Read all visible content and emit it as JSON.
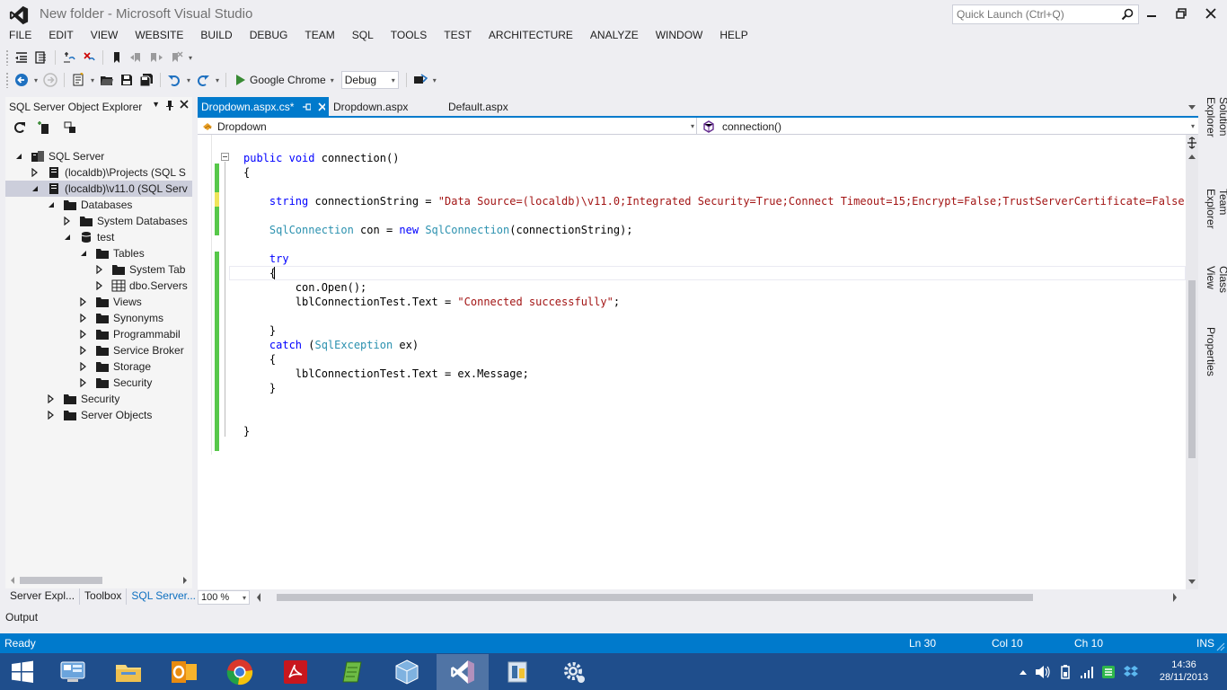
{
  "window": {
    "title": "New folder - Microsoft Visual Studio",
    "quick_launch_placeholder": "Quick Launch (Ctrl+Q)"
  },
  "menu": [
    "FILE",
    "EDIT",
    "VIEW",
    "WEBSITE",
    "BUILD",
    "DEBUG",
    "TEAM",
    "SQL",
    "TOOLS",
    "TEST",
    "ARCHITECTURE",
    "ANALYZE",
    "WINDOW",
    "HELP"
  ],
  "toolbar": {
    "run_target": "Google Chrome",
    "configuration": "Debug"
  },
  "sql_explorer": {
    "title": "SQL Server Object Explorer",
    "tree": [
      {
        "label": "SQL Server",
        "depth": 0,
        "expanded": true,
        "icon": "server-group-icon"
      },
      {
        "label": "(localdb)\\Projects (SQL S",
        "depth": 1,
        "expanded": false,
        "icon": "server-icon"
      },
      {
        "label": "(localdb)\\v11.0 (SQL Serv",
        "depth": 1,
        "expanded": true,
        "icon": "server-icon",
        "selected": true
      },
      {
        "label": "Databases",
        "depth": 2,
        "expanded": true,
        "icon": "folder-icon"
      },
      {
        "label": "System Databases",
        "depth": 3,
        "expanded": false,
        "icon": "folder-icon"
      },
      {
        "label": "test",
        "depth": 3,
        "expanded": true,
        "icon": "database-icon"
      },
      {
        "label": "Tables",
        "depth": 4,
        "expanded": true,
        "icon": "folder-icon"
      },
      {
        "label": "System Tab",
        "depth": 5,
        "expanded": false,
        "icon": "folder-icon"
      },
      {
        "label": "dbo.Servers",
        "depth": 5,
        "expanded": false,
        "icon": "table-icon"
      },
      {
        "label": "Views",
        "depth": 4,
        "expanded": false,
        "icon": "folder-icon"
      },
      {
        "label": "Synonyms",
        "depth": 4,
        "expanded": false,
        "icon": "folder-icon"
      },
      {
        "label": "Programmabil",
        "depth": 4,
        "expanded": false,
        "icon": "folder-icon"
      },
      {
        "label": "Service Broker",
        "depth": 4,
        "expanded": false,
        "icon": "folder-icon"
      },
      {
        "label": "Storage",
        "depth": 4,
        "expanded": false,
        "icon": "folder-icon"
      },
      {
        "label": "Security",
        "depth": 4,
        "expanded": false,
        "icon": "folder-icon"
      },
      {
        "label": "Security",
        "depth": 2,
        "expanded": false,
        "icon": "folder-icon"
      },
      {
        "label": "Server Objects",
        "depth": 2,
        "expanded": false,
        "icon": "folder-icon"
      }
    ],
    "bottom_tabs": [
      "Server Expl...",
      "Toolbox",
      "SQL Server..."
    ],
    "active_bottom_tab": 2
  },
  "output_label": "Output",
  "doc_tabs": [
    {
      "label": "Dropdown.aspx.cs*",
      "active": true
    },
    {
      "label": "Dropdown.aspx",
      "active": false
    },
    {
      "label": "Default.aspx",
      "active": false
    }
  ],
  "navbar": {
    "type_combo": "Dropdown",
    "member_combo": "connection()"
  },
  "code": [
    [
      [
        "kw",
        "public"
      ],
      [
        "t",
        " "
      ],
      [
        "kw",
        "void"
      ],
      [
        "t",
        " connection()"
      ]
    ],
    [
      [
        "t",
        "{"
      ]
    ],
    [],
    [
      [
        "t",
        "    "
      ],
      [
        "kw",
        "string"
      ],
      [
        "t",
        " connectionString = "
      ],
      [
        "st",
        "\"Data Source=(localdb)\\v11.0;Integrated Security=True;Connect Timeout=15;Encrypt=False;TrustServerCertificate=False\""
      ],
      [
        "t",
        ";"
      ]
    ],
    [],
    [
      [
        "t",
        "    "
      ],
      [
        "ty",
        "SqlConnection"
      ],
      [
        "t",
        " con = "
      ],
      [
        "kw",
        "new"
      ],
      [
        "t",
        " "
      ],
      [
        "ty",
        "SqlConnection"
      ],
      [
        "t",
        "(connectionString);"
      ]
    ],
    [],
    [
      [
        "t",
        "    "
      ],
      [
        "kw",
        "try"
      ]
    ],
    [
      [
        "t",
        "    {"
      ]
    ],
    [
      [
        "t",
        "        con.Open();"
      ]
    ],
    [
      [
        "t",
        "        lblConnectionTest.Text = "
      ],
      [
        "st",
        "\"Connected successfully\""
      ],
      [
        "t",
        ";"
      ]
    ],
    [],
    [
      [
        "t",
        "    }"
      ]
    ],
    [
      [
        "t",
        "    "
      ],
      [
        "kw",
        "catch"
      ],
      [
        "t",
        " ("
      ],
      [
        "ty",
        "SqlException"
      ],
      [
        "t",
        " ex)"
      ]
    ],
    [
      [
        "t",
        "    {"
      ]
    ],
    [
      [
        "t",
        "        lblConnectionTest.Text = ex.Message;"
      ]
    ],
    [
      [
        "t",
        "    }"
      ]
    ],
    [],
    [],
    [
      [
        "t",
        "}"
      ]
    ]
  ],
  "editor_zoom": "100 %",
  "right_tabs": [
    "Solution Explorer",
    "Team Explorer",
    "Class View",
    "Properties"
  ],
  "status": {
    "ready": "Ready",
    "ln": "Ln 30",
    "col": "Col 10",
    "ch": "Ch 10",
    "ins": "INS"
  },
  "taskbar": {
    "apps": [
      "start-button",
      "control-panel-icon",
      "file-explorer-icon",
      "outlook-icon",
      "chrome-icon",
      "acrobat-icon",
      "notepad-icon",
      "virtualbox-icon",
      "visual-studio-icon",
      "sql-tools-icon",
      "settings-icon"
    ],
    "time": "14:36",
    "date": "28/11/2013"
  },
  "colors": {
    "accent": "#007acc",
    "selection": "#cccedb",
    "change_saved": "#57c84a",
    "change_unsaved": "#efe55b"
  }
}
